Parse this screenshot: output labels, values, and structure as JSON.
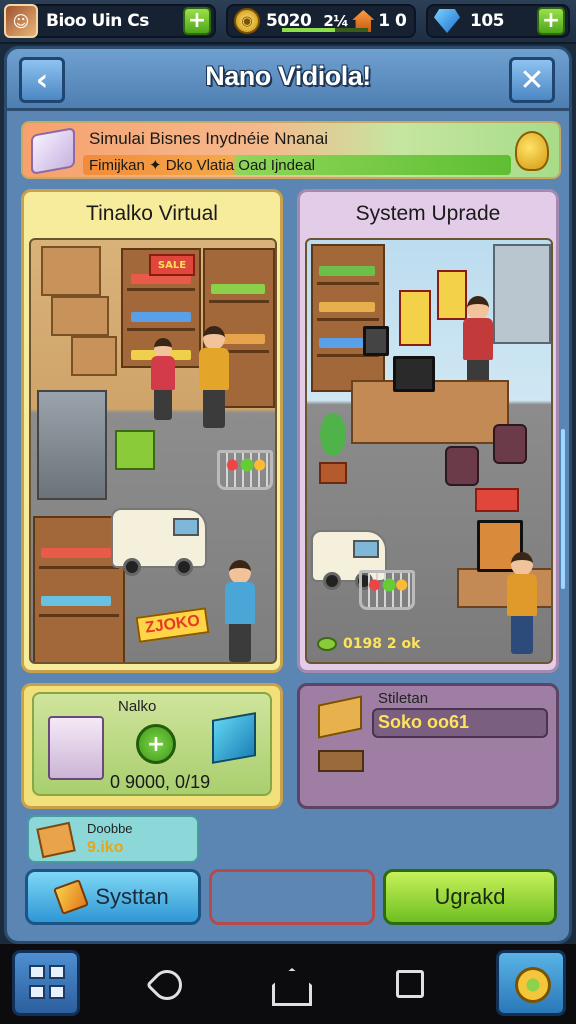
{
  "hud": {
    "player_name": "Bioo Uin Cs",
    "coins": "5020",
    "multiplier": "2¼",
    "level": "1 0",
    "gems": "105"
  },
  "panel": {
    "title": "Nano Vidiola!"
  },
  "banner": {
    "line1": "Simulai Bisnes Inydnéie Nnanai",
    "line2": "Fimijkan ✦ Dko Vlatia Oad Ijndeal"
  },
  "cards": {
    "left_title": "Tinalko Virtual",
    "left_sign": "ZJOKO",
    "right_title": "System Uprade",
    "right_footer": "0198 2 ok"
  },
  "info_left": {
    "title": "Nalko",
    "value": "0 9000, 0/19"
  },
  "info_right": {
    "title": "Stiletan",
    "value": "Soko oo61"
  },
  "small_card": {
    "title": "Doobbe",
    "value": "9.iko"
  },
  "buttons": {
    "system": "Systtan",
    "upgrade": "Ugrakd"
  },
  "colors": {
    "panel": "#5b86b3",
    "left_card": "#f6ec9c",
    "right_card": "#e3cce8",
    "upgrade_green": "#6fbf21",
    "system_blue": "#2f97d4"
  },
  "icons": {
    "hud": [
      "avatar",
      "plus-icon",
      "coin-icon",
      "house-icon",
      "gem-icon"
    ],
    "nav": [
      "menu-grid-icon",
      "back-icon",
      "home-icon",
      "recent-apps-icon",
      "settings-gear-icon"
    ]
  }
}
